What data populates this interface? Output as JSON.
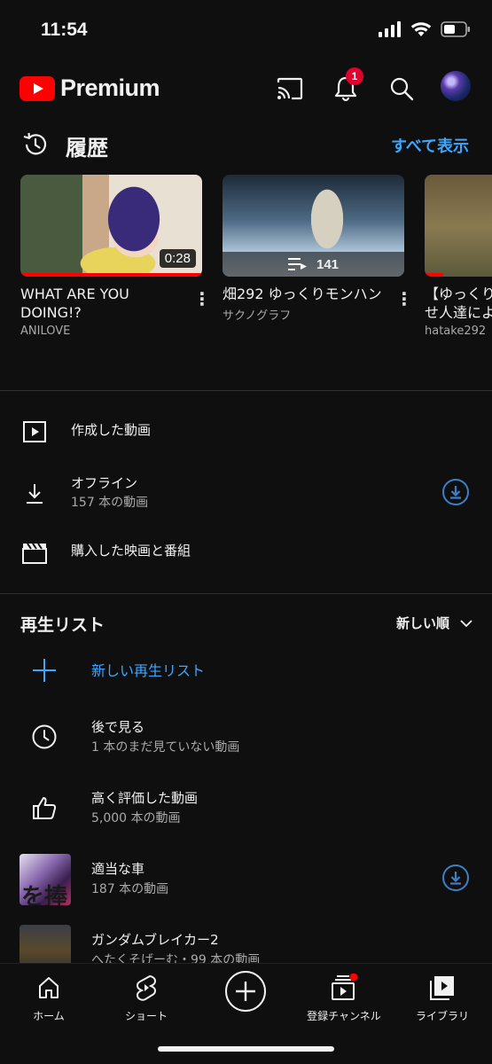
{
  "status": {
    "time": "11:54"
  },
  "header": {
    "logo_text": "Premium",
    "notification_count": "1"
  },
  "history": {
    "title": "履歴",
    "see_all": "すべて表示",
    "videos": [
      {
        "title": "WHAT ARE YOU DOING!?",
        "channel": "ANILOVE",
        "duration": "0:28",
        "progress": 1.0
      },
      {
        "title": "畑292 ゆっくりモンハン",
        "channel": "サクノグラフ",
        "playlist_count": "141"
      },
      {
        "title": "【ゆっくりせ人達によ",
        "channel": "hatake292",
        "progress": 0.1
      }
    ]
  },
  "library": {
    "items": [
      {
        "title": "作成した動画",
        "subtitle": ""
      },
      {
        "title": "オフライン",
        "subtitle": "157 本の動画"
      },
      {
        "title": "購入した映画と番組",
        "subtitle": ""
      }
    ]
  },
  "playlists": {
    "title": "再生リスト",
    "sort_label": "新しい順",
    "new_playlist": "新しい再生リスト",
    "items": [
      {
        "name": "後で見る",
        "count": "1 本のまだ見ていない動画"
      },
      {
        "name": "高く評価した動画",
        "count": "5,000 本の動画"
      },
      {
        "name": "適当な車",
        "count": "187 本の動画",
        "thumb_text": "を捧"
      },
      {
        "name": "ガンダムブレイカー2",
        "count": "へたくそげーむ・99 本の動画"
      }
    ]
  },
  "nav": {
    "items": [
      {
        "label": "ホーム"
      },
      {
        "label": "ショート"
      },
      {
        "label": "登録チャンネル"
      },
      {
        "label": "ライブラリ"
      }
    ]
  },
  "colors": {
    "background": "#0f0f0f",
    "accent_blue": "#3ea6ff",
    "youtube_red": "#ff0000",
    "badge_red": "#e1002d"
  }
}
